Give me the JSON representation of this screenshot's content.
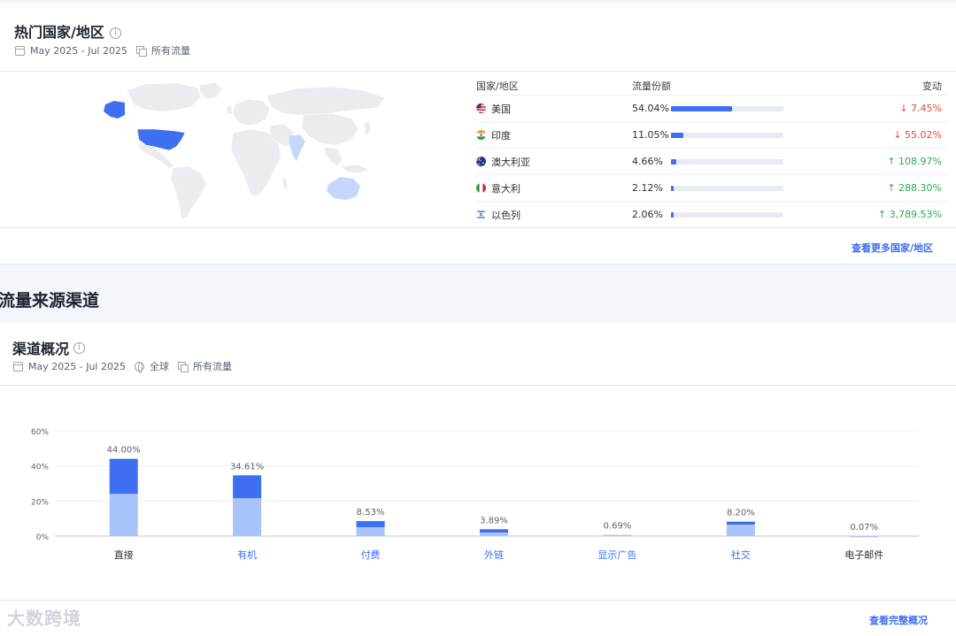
{
  "countries": {
    "title": "热门国家/地区",
    "date_range": "May 2025 - Jul 2025",
    "traffic_type": "所有流量",
    "columns": [
      "国家/地区",
      "流量份额",
      "变动"
    ],
    "rows": [
      {
        "country": "美国",
        "share": "54.04%",
        "share_value": 54.04,
        "change": "7.45%",
        "direction": "down",
        "flag": "us-flag"
      },
      {
        "country": "印度",
        "share": "11.05%",
        "share_value": 11.05,
        "change": "55.02%",
        "direction": "down",
        "flag": "india-flag"
      },
      {
        "country": "澳大利亚",
        "share": "4.66%",
        "share_value": 4.66,
        "change": "108.97%",
        "direction": "up",
        "flag": "australia-flag"
      },
      {
        "country": "意大利",
        "share": "2.12%",
        "share_value": 2.12,
        "change": "288.30%",
        "direction": "up",
        "flag": "italy-flag"
      },
      {
        "country": "以色列",
        "share": "2.06%",
        "share_value": 2.06,
        "change": "3,789.53%",
        "direction": "up",
        "flag": "israel-flag"
      }
    ],
    "more_link": "查看更多国家/地区",
    "colors": {
      "bar": "#3d6ff0",
      "down": "#e5483a",
      "up": "#2ea84f"
    }
  },
  "channels_section": {
    "heading": "流量来源渠道",
    "card_title": "渠道概况",
    "date_range": "May 2025 - Jul 2025",
    "region": "全球",
    "traffic_type": "所有流量",
    "full_link": "查看完整概况"
  },
  "chart_data": {
    "type": "bar",
    "categories": [
      "直接",
      "有机",
      "付费",
      "外链",
      "显示广告",
      "社交",
      "电子邮件"
    ],
    "values": [
      44.0,
      34.61,
      8.53,
      3.89,
      0.69,
      8.2,
      0.07
    ],
    "value_labels": [
      "44.00%",
      "34.61%",
      "8.53%",
      "3.89%",
      "0.69%",
      "8.20%",
      "0.07%"
    ],
    "light_values": [
      24,
      21.5,
      5,
      2,
      0.69,
      6.5,
      0.07
    ],
    "ylim": [
      0,
      60
    ],
    "yticks": [
      "0%",
      "20%",
      "40%",
      "60%"
    ],
    "grid": true,
    "colors": {
      "dark": "#3d6ff0",
      "light": "#a9c4fb"
    }
  },
  "watermark": "大数跨境"
}
